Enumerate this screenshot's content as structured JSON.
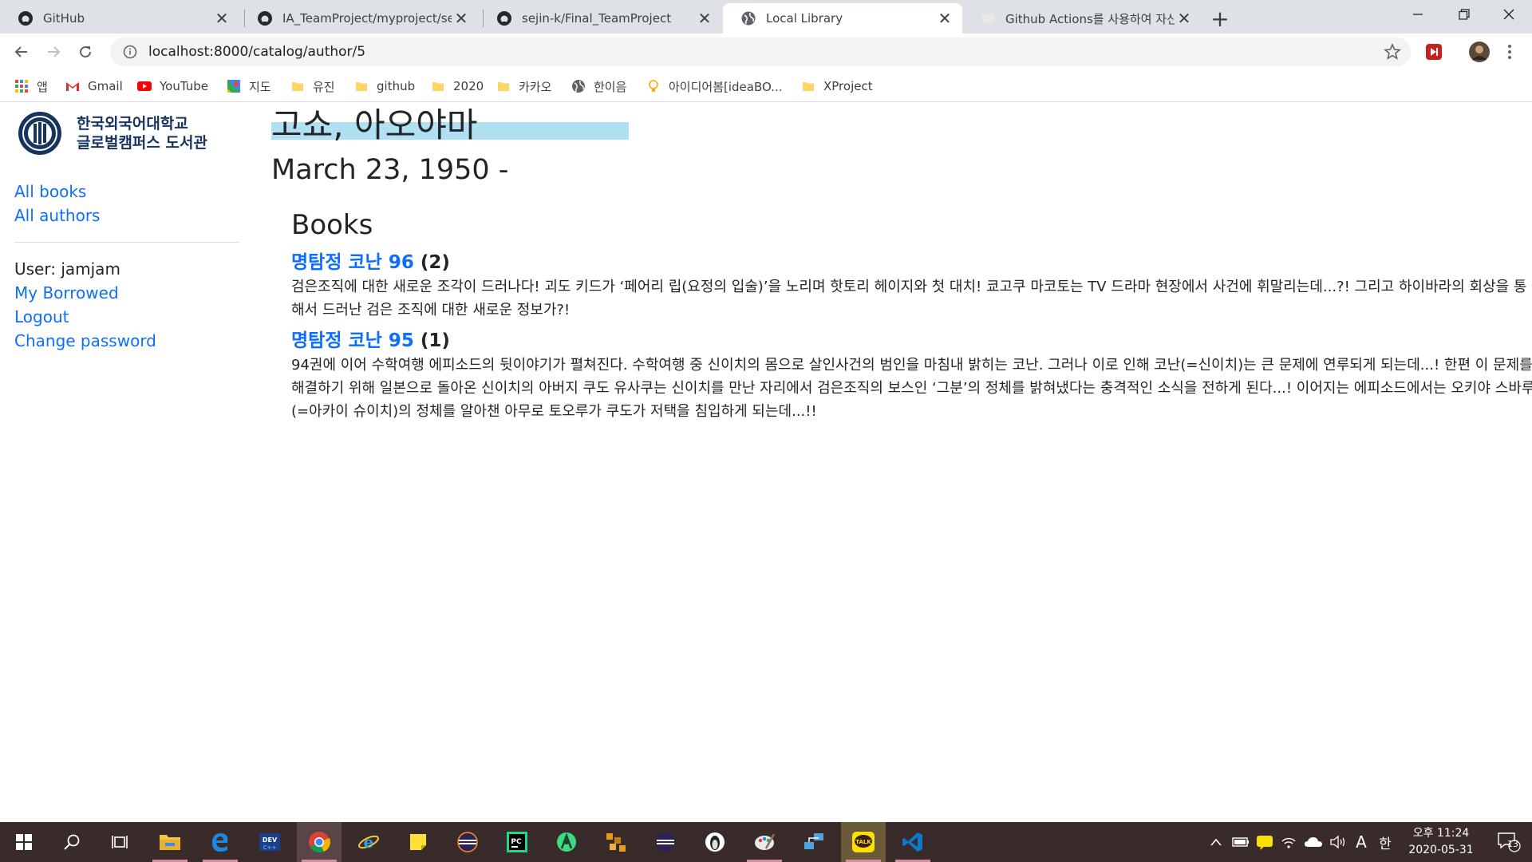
{
  "browser": {
    "tabs": [
      {
        "title": "GitHub",
        "icon": "github-icon"
      },
      {
        "title": "IA_TeamProject/myproject/searc",
        "icon": "github-icon"
      },
      {
        "title": "sejin-k/Final_TeamProject",
        "icon": "github-icon"
      },
      {
        "title": "Local Library",
        "icon": "globe-icon"
      },
      {
        "title": "Github Actions를 사용하여 자신",
        "icon": "page-icon"
      }
    ],
    "url": "localhost:8000/catalog/author/5",
    "bookmarks": [
      {
        "label": "앱",
        "icon": "apps-icon"
      },
      {
        "label": "Gmail",
        "icon": "gmail-icon"
      },
      {
        "label": "YouTube",
        "icon": "youtube-icon"
      },
      {
        "label": "지도",
        "icon": "maps-icon"
      },
      {
        "label": "유진",
        "icon": "folder-icon"
      },
      {
        "label": "github",
        "icon": "folder-icon"
      },
      {
        "label": "2020",
        "icon": "folder-icon"
      },
      {
        "label": "카카오",
        "icon": "folder-icon"
      },
      {
        "label": "한이음",
        "icon": "globe-icon"
      },
      {
        "label": "아이디어봄[ideaBO...",
        "icon": "lightbulb-icon"
      },
      {
        "label": "XProject",
        "icon": "folder-icon"
      }
    ]
  },
  "sidebar": {
    "logo_line1": "한국외국어대학교",
    "logo_line2": "글로벌캠퍼스 도서관",
    "links": [
      "All books",
      "All authors"
    ],
    "user_label": "User: jamjam",
    "user_links": [
      "My Borrowed",
      "Logout",
      "Change password"
    ]
  },
  "author": {
    "name": "고쇼, 아오야마",
    "dates": "March 23, 1950 -"
  },
  "books_heading": "Books",
  "books": [
    {
      "title": "명탐정 코난 96",
      "count": "(2)",
      "summary": "검은조직에 대한 새로운 조각이 드러나다! 괴도 키드가 ‘페어리 립(요정의 입술)’을 노리며 핫토리 헤이지와 첫 대치! 쿄고쿠 마코토는 TV 드라마 현장에서 사건에 휘말리는데...?! 그리고 하이바라의 회상을 통해서 드러난 검은 조직에 대한 새로운 정보가?!"
    },
    {
      "title": "명탐정 코난 95",
      "count": "(1)",
      "summary": "94권에 이어 수학여행 에피소드의 뒷이야기가 펼쳐진다. 수학여행 중 신이치의 몸으로 살인사건의 범인을 마침내 밝히는 코난. 그러나 이로 인해 코난(=신이치)는 큰 문제에 연루되게 되는데...! 한편 이 문제를 해결하기 위해 일본으로 돌아온 신이치의 아버지 쿠도 유사쿠는 신이치를 만난 자리에서 검은조직의 보스인 ‘그분’의 정체를 밝혀냈다는 충격적인 소식을 전하게 된다...! 이어지는 에피소드에서는 오키야 스바루(=아카이 슈이치)의 정체를 알아챈 아무로 토오루가 쿠도가 저택을 침입하게 되는데...!!"
    }
  ],
  "taskbar": {
    "time": "오후 11:24",
    "date": "2020-05-31",
    "notification_count": "13",
    "ime_lang": "A",
    "ime_mode": "한"
  },
  "colors": {
    "link": "#0d6efd",
    "highlight": "#b0e0f2",
    "taskbar": "#3a2b2b",
    "tabstrip": "#dee1e6"
  }
}
